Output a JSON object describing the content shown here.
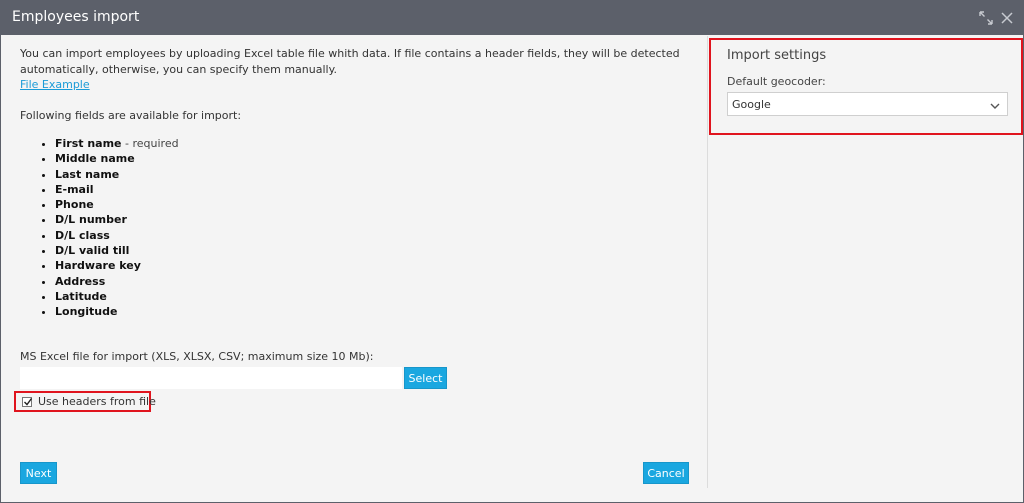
{
  "window": {
    "title": "Employees import"
  },
  "intro": {
    "text": "You can import employees by uploading Excel table file whith data. If file contains a header fields, they will be detected automatically, otherwise, you can specify them manually.",
    "file_example_link": "File Example",
    "fields_label": "Following fields are available for import:"
  },
  "fields": [
    {
      "name": "First name",
      "note": " - required"
    },
    {
      "name": "Middle name",
      "note": ""
    },
    {
      "name": "Last name",
      "note": ""
    },
    {
      "name": "E-mail",
      "note": ""
    },
    {
      "name": "Phone",
      "note": ""
    },
    {
      "name": "D/L number",
      "note": ""
    },
    {
      "name": "D/L class",
      "note": ""
    },
    {
      "name": "D/L valid till",
      "note": ""
    },
    {
      "name": "Hardware key",
      "note": ""
    },
    {
      "name": "Address",
      "note": ""
    },
    {
      "name": "Latitude",
      "note": ""
    },
    {
      "name": "Longitude",
      "note": ""
    }
  ],
  "upload": {
    "label": "MS Excel file for import (XLS, XLSX, CSV; maximum size 10 Mb):",
    "file_value": "",
    "select_button": "Select",
    "use_headers_label": "Use headers from file",
    "use_headers_checked": true
  },
  "footer": {
    "next_button": "Next",
    "cancel_button": "Cancel"
  },
  "settings": {
    "title": "Import settings",
    "geocoder_label": "Default geocoder:",
    "geocoder_value": "Google"
  },
  "colors": {
    "titlebar": "#5c606a",
    "accent": "#1aa7e0",
    "highlight": "#e0141e",
    "link": "#1a9bd7"
  },
  "icons": {
    "expand": "expand-icon",
    "close": "close-icon",
    "check": "check-icon",
    "dropdown": "chevron-down-icon"
  }
}
